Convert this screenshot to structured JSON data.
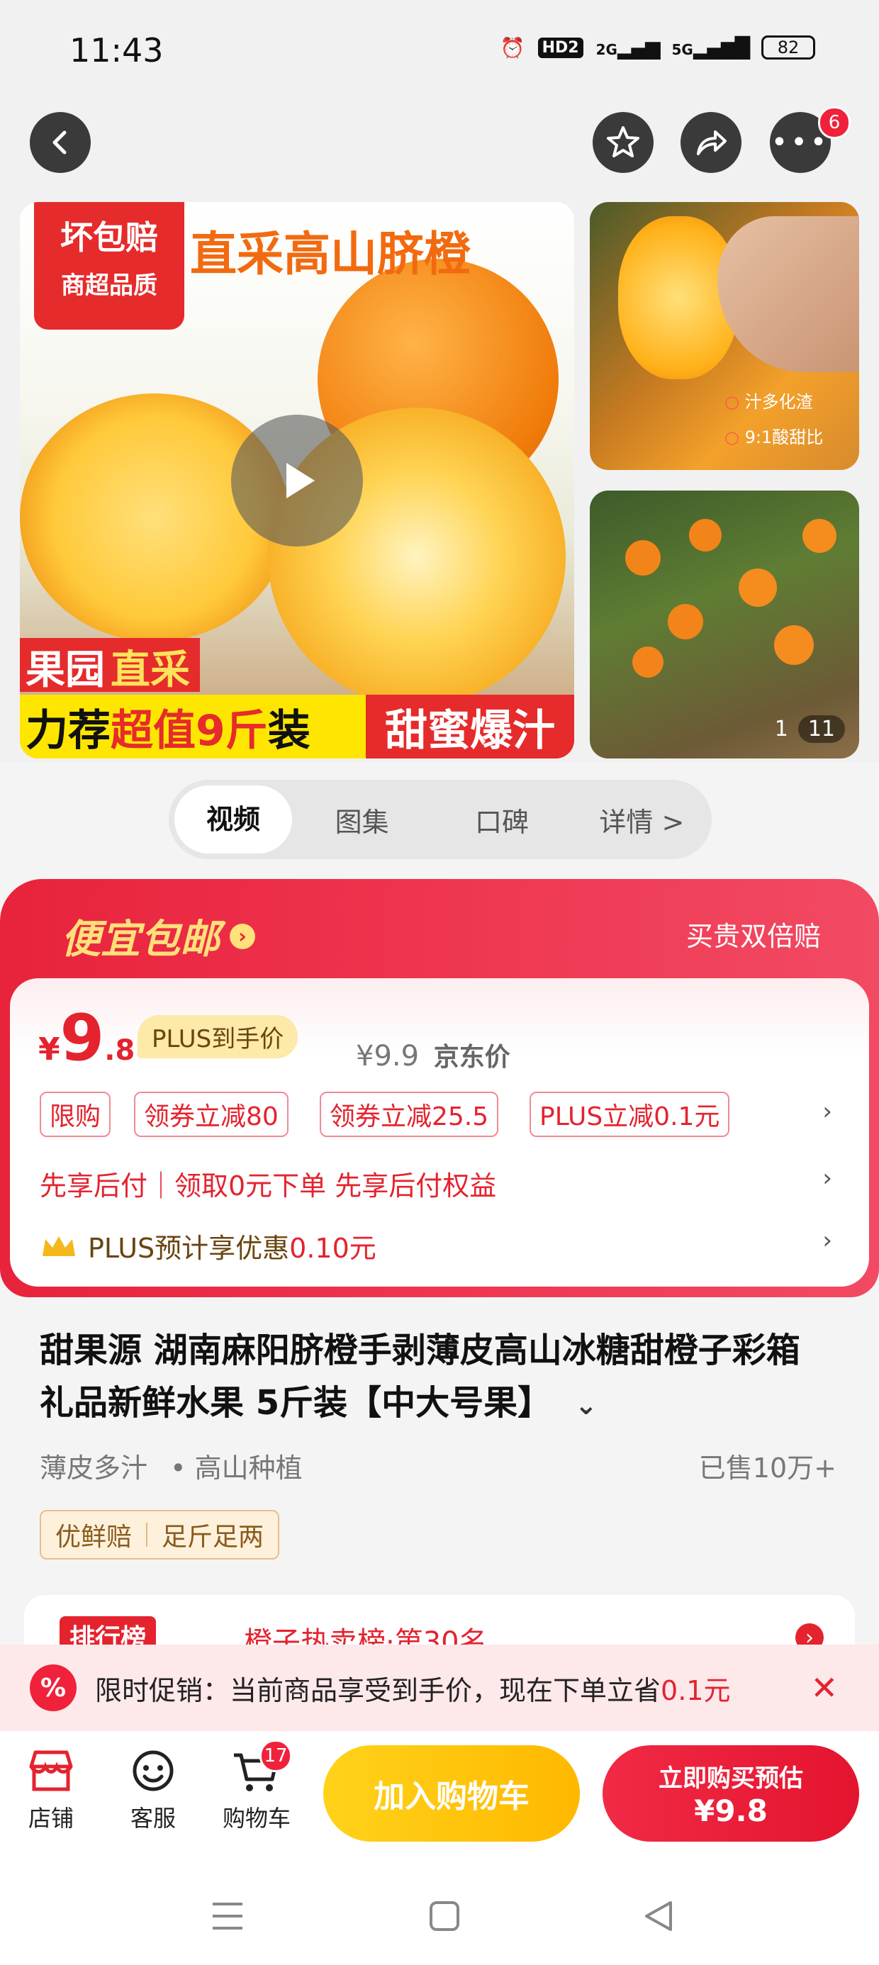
{
  "status_bar": {
    "time": "11:43",
    "hd_label": "HD2",
    "net1": "2G",
    "net2": "5G",
    "battery": "82"
  },
  "top_nav": {
    "more_badge": "6"
  },
  "gallery": {
    "banner_top_left_1": "坏包赔",
    "banner_top_left_2": "商超品质",
    "banner_title": "直采高山脐橙",
    "banner_tag1_a": "果园",
    "banner_tag1_b": "直采",
    "banner_bottom_a": "力荐",
    "banner_bottom_b": "超值9斤",
    "banner_bottom_c": "装",
    "banner_bottom_d": "甜蜜爆汁",
    "side_label_1": "汁多化渣",
    "side_label_2": "9:1酸甜比",
    "counter_current": "1",
    "counter_total": "11"
  },
  "media_tabs": [
    {
      "label": "视频"
    },
    {
      "label": "图集"
    },
    {
      "label": "口碑"
    },
    {
      "label": "详情 >"
    }
  ],
  "price_card": {
    "header_left": "便宜包邮",
    "header_right": "买贵双倍赔",
    "currency": "¥",
    "price_int": "9",
    "price_dec": ".8",
    "plus_label": "PLUS到手价",
    "jd_price": "¥9.9",
    "jd_price_label": "京东价",
    "coupons": [
      "限购",
      "领券立减80",
      "领券立减25.5",
      "PLUS立减0.1元"
    ],
    "pay_later": "先享后付｜领取0元下单 先享后付权益",
    "plus_estimate_prefix": "PLUS预计享优惠",
    "plus_estimate_value": "0.10元"
  },
  "product": {
    "title": "甜果源 湖南麻阳脐橙手剥薄皮高山冰糖甜橙子彩箱礼品新鲜水果 5斤装【中大号果】",
    "feature1": "薄皮多汁",
    "feature2": "• 高山种植",
    "sold": "已售10万+",
    "tag1": "优鲜赔",
    "tag2": "足斤足两"
  },
  "rank": {
    "badge": "排行榜",
    "text": "橙子热卖榜·第30名"
  },
  "promo": {
    "text_prefix": "限时促销：当前商品享受到手价，现在下单立省",
    "text_value": "0.1元"
  },
  "bottom_bar": {
    "store": "店铺",
    "service": "客服",
    "cart": "购物车",
    "cart_badge": "17",
    "add_cart": "加入购物车",
    "buy_now": "立即购买预估",
    "buy_price": "¥9.8"
  },
  "colors": {
    "accent_red": "#e4232f",
    "accent_yellow": "#ffc20e"
  }
}
